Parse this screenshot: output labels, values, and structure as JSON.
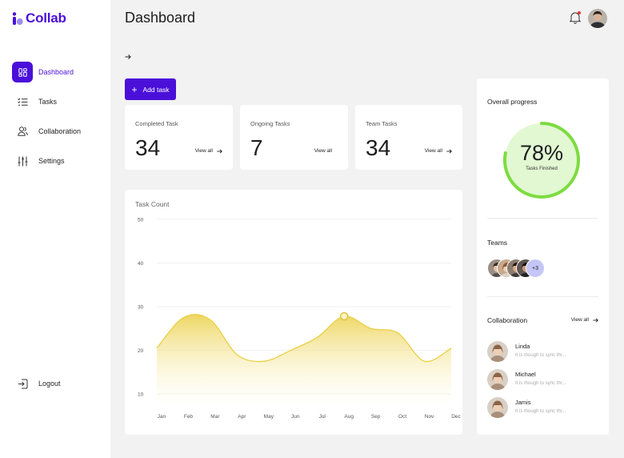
{
  "app": {
    "name": "Collab"
  },
  "sidebar": {
    "items": [
      {
        "label": "Dashboard",
        "icon": "dashboard-icon",
        "active": true
      },
      {
        "label": "Tasks",
        "icon": "tasks-icon",
        "active": false
      },
      {
        "label": "Collaboration",
        "icon": "users-icon",
        "active": false
      },
      {
        "label": "Settings",
        "icon": "sliders-icon",
        "active": false
      }
    ],
    "logout_label": "Logout"
  },
  "header": {
    "title": "Dashboard"
  },
  "toolbar": {
    "add_task_label": "Add task"
  },
  "stats": [
    {
      "label": "Completed Task",
      "value": "34",
      "link": "View all"
    },
    {
      "label": "Ongoing Tasks",
      "value": "7",
      "link": "View all"
    },
    {
      "label": "Team Tasks",
      "value": "34",
      "link": "View all"
    }
  ],
  "chart": {
    "title": "Task Count"
  },
  "chart_data": {
    "type": "area",
    "title": "Task Count",
    "categories": [
      "Jan",
      "Feb",
      "Mar",
      "Apr",
      "May",
      "Jun",
      "Jul",
      "Aug",
      "Sep",
      "Oct",
      "Nov",
      "Dec"
    ],
    "values": [
      20.5,
      27.5,
      27,
      19,
      17.5,
      20,
      23,
      27.8,
      25,
      24,
      17.5,
      20.5
    ],
    "yticks": [
      10,
      20,
      30,
      40,
      50
    ],
    "ylim": [
      8,
      52
    ],
    "highlight_index": 7,
    "grid": true,
    "color": "#e9d043"
  },
  "progress": {
    "heading": "Overall progress",
    "percent_text": "78%",
    "percent": 78,
    "caption": "Tasks Finished",
    "color": "#7ddc3f",
    "fill": "#e1f8d3"
  },
  "teams": {
    "heading": "Teams",
    "more_label": "+3"
  },
  "collaboration": {
    "heading": "Collaboration",
    "link": "View all",
    "people": [
      {
        "name": "Linda",
        "message": "It is though to sync thr..."
      },
      {
        "name": "Michael",
        "message": "It is though to sync thr..."
      },
      {
        "name": "Jamis",
        "message": "It is though to sync thr..."
      }
    ]
  },
  "colors": {
    "accent": "#4a10d9",
    "background": "#f2f2f2",
    "card": "#ffffff",
    "notification": "#e53935"
  }
}
